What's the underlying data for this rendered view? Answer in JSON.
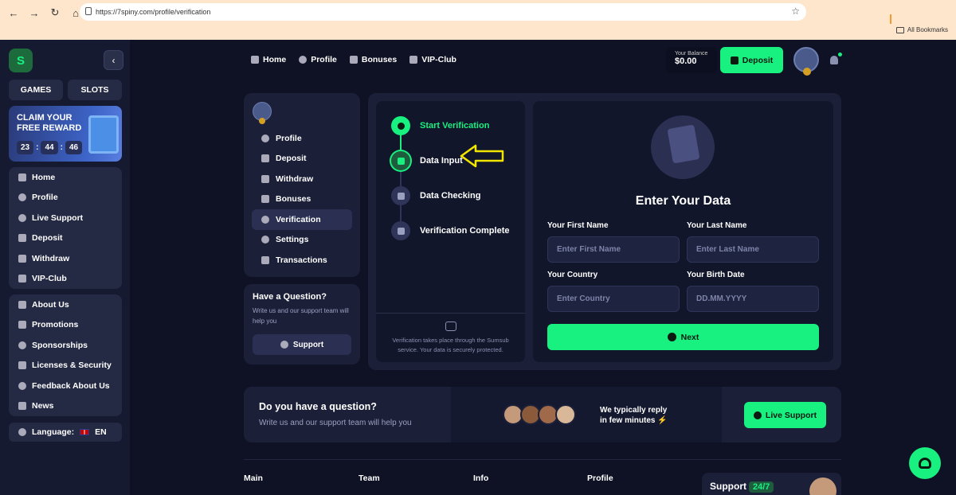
{
  "browser": {
    "url": "https://7spiny.com/profile/verification",
    "bookmarks_label": "All Bookmarks"
  },
  "sidebar": {
    "tab_games": "GAMES",
    "tab_slots": "SLOTS",
    "promo": {
      "title_line1": "CLAIM YOUR",
      "title_line2": "FREE REWARD",
      "timer": [
        "23",
        "44",
        "46"
      ]
    },
    "main_items": [
      {
        "label": "Home",
        "icon": "home-icon"
      },
      {
        "label": "Profile",
        "icon": "user-icon"
      },
      {
        "label": "Live Support",
        "icon": "chat-icon"
      },
      {
        "label": "Deposit",
        "icon": "wallet-icon"
      },
      {
        "label": "Withdraw",
        "icon": "cash-icon"
      },
      {
        "label": "VIP-Club",
        "icon": "star-icon"
      }
    ],
    "info_items": [
      {
        "label": "About Us",
        "icon": "info-icon"
      },
      {
        "label": "Promotions",
        "icon": "gift-icon"
      },
      {
        "label": "Sponsorships",
        "icon": "medal-icon"
      },
      {
        "label": "Licenses & Security",
        "icon": "shield-icon"
      },
      {
        "label": "Feedback About Us",
        "icon": "feedback-icon"
      },
      {
        "label": "News",
        "icon": "news-icon"
      }
    ],
    "language_label": "Language:",
    "language_value": "EN"
  },
  "header": {
    "nav": [
      {
        "label": "Home",
        "icon": "home-icon"
      },
      {
        "label": "Profile",
        "icon": "user-icon"
      },
      {
        "label": "Bonuses",
        "icon": "gift-icon"
      },
      {
        "label": "VIP-Club",
        "icon": "star-icon"
      }
    ],
    "balance_label": "Your Balance",
    "balance_value": "$0.00",
    "deposit_label": "Deposit"
  },
  "profile_menu": {
    "items": [
      {
        "label": "Profile",
        "icon": "user-icon",
        "active": false
      },
      {
        "label": "Deposit",
        "icon": "wallet-icon",
        "active": false
      },
      {
        "label": "Withdraw",
        "icon": "cash-icon",
        "active": false
      },
      {
        "label": "Bonuses",
        "icon": "gift-icon",
        "active": false
      },
      {
        "label": "Verification",
        "icon": "check-badge-icon",
        "active": true
      },
      {
        "label": "Settings",
        "icon": "gear-icon",
        "active": false
      },
      {
        "label": "Transactions",
        "icon": "list-icon",
        "active": false
      }
    ],
    "question": {
      "title": "Have a Question?",
      "subtitle": "Write us and our support team will help you",
      "button": "Support"
    }
  },
  "verification": {
    "steps": [
      {
        "label": "Start Verification",
        "state": "done"
      },
      {
        "label": "Data Input",
        "state": "current"
      },
      {
        "label": "Data Checking",
        "state": "pending"
      },
      {
        "label": "Verification Complete",
        "state": "pending"
      }
    ],
    "sumsub_note": "Verification takes place through the Sumsub service. Your data is securely protected.",
    "form": {
      "title": "Enter Your Data",
      "first_name_label": "Your First Name",
      "first_name_placeholder": "Enter First Name",
      "last_name_label": "Your Last Name",
      "last_name_placeholder": "Enter Last Name",
      "country_label": "Your Country",
      "country_placeholder": "Enter Country",
      "birth_label": "Your Birth Date",
      "birth_placeholder": "DD.MM.YYYY",
      "next_label": "Next"
    }
  },
  "contact": {
    "title": "Do you have a question?",
    "subtitle": "Write us and our support team will help you",
    "reply_line1": "We typically reply",
    "reply_line2": "in few minutes",
    "live_support": "Live Support"
  },
  "footer": {
    "columns": [
      "Main",
      "Team",
      "Info",
      "Profile"
    ],
    "support_label": "Support",
    "support_badge": "24/7"
  },
  "colors": {
    "accent": "#18f07f",
    "background": "#0f1224",
    "panel": "#1b1f38",
    "annotation_arrow": "#f2e600"
  }
}
